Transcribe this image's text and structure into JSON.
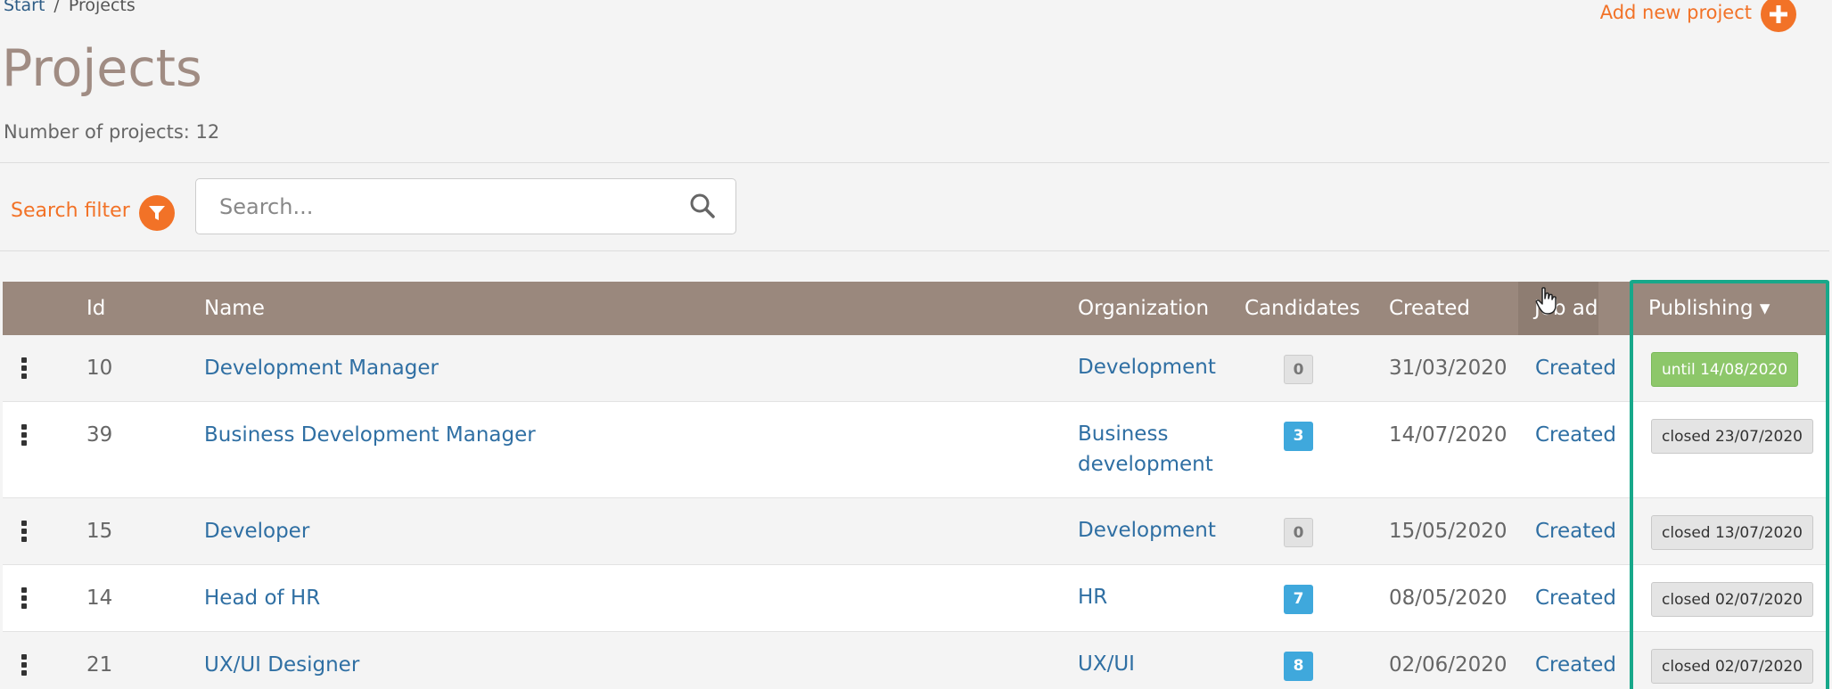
{
  "breadcrumb": {
    "home": "Start",
    "separator": "/",
    "current": "Projects"
  },
  "header": {
    "add_label": "Add new project"
  },
  "page": {
    "title": "Projects",
    "count_text": "Number of projects: 12"
  },
  "filter": {
    "label": "Search filter"
  },
  "search": {
    "placeholder": "Search..."
  },
  "table": {
    "columns": [
      "Id",
      "Name",
      "Organization",
      "Candidates",
      "Created",
      "Job ad",
      "Publishing"
    ],
    "sort_indicator": "▾",
    "rows": [
      {
        "id": "10",
        "name": "Development Manager",
        "org_line1": "Development",
        "org_line2": "",
        "candidates": "0",
        "created": "31/03/2020",
        "job_ad": "Created",
        "publishing": "until 14/08/2020",
        "pub_state": "open"
      },
      {
        "id": "39",
        "name": "Business Development Manager",
        "org_line1": "Business",
        "org_line2": "development",
        "candidates": "3",
        "created": "14/07/2020",
        "job_ad": "Created",
        "publishing": "closed 23/07/2020",
        "pub_state": "closed"
      },
      {
        "id": "15",
        "name": "Developer",
        "org_line1": "Development",
        "org_line2": "",
        "candidates": "0",
        "created": "15/05/2020",
        "job_ad": "Created",
        "publishing": "closed 13/07/2020",
        "pub_state": "closed"
      },
      {
        "id": "14",
        "name": "Head of HR",
        "org_line1": "HR",
        "org_line2": "",
        "candidates": "7",
        "created": "08/05/2020",
        "job_ad": "Created",
        "publishing": "closed 02/07/2020",
        "pub_state": "closed"
      },
      {
        "id": "21",
        "name": "UX/UI Designer",
        "org_line1": "UX/UI",
        "org_line2": "",
        "candidates": "8",
        "created": "02/06/2020",
        "job_ad": "Created",
        "publishing": "closed 02/07/2020",
        "pub_state": "closed"
      }
    ]
  },
  "colors": {
    "accent": "#f27227",
    "link": "#2f6fa3",
    "header_bg": "#9a887d",
    "highlight": "#17a88a",
    "badge_blue": "#3fa8dc",
    "badge_green": "#8dc76a"
  },
  "icons": {
    "add": "plus-circle-icon",
    "filter": "funnel-icon",
    "search": "magnifier-icon",
    "row_menu": "vertical-dots-icon",
    "sort": "caret-down-icon",
    "pointer": "hand-cursor-icon"
  }
}
